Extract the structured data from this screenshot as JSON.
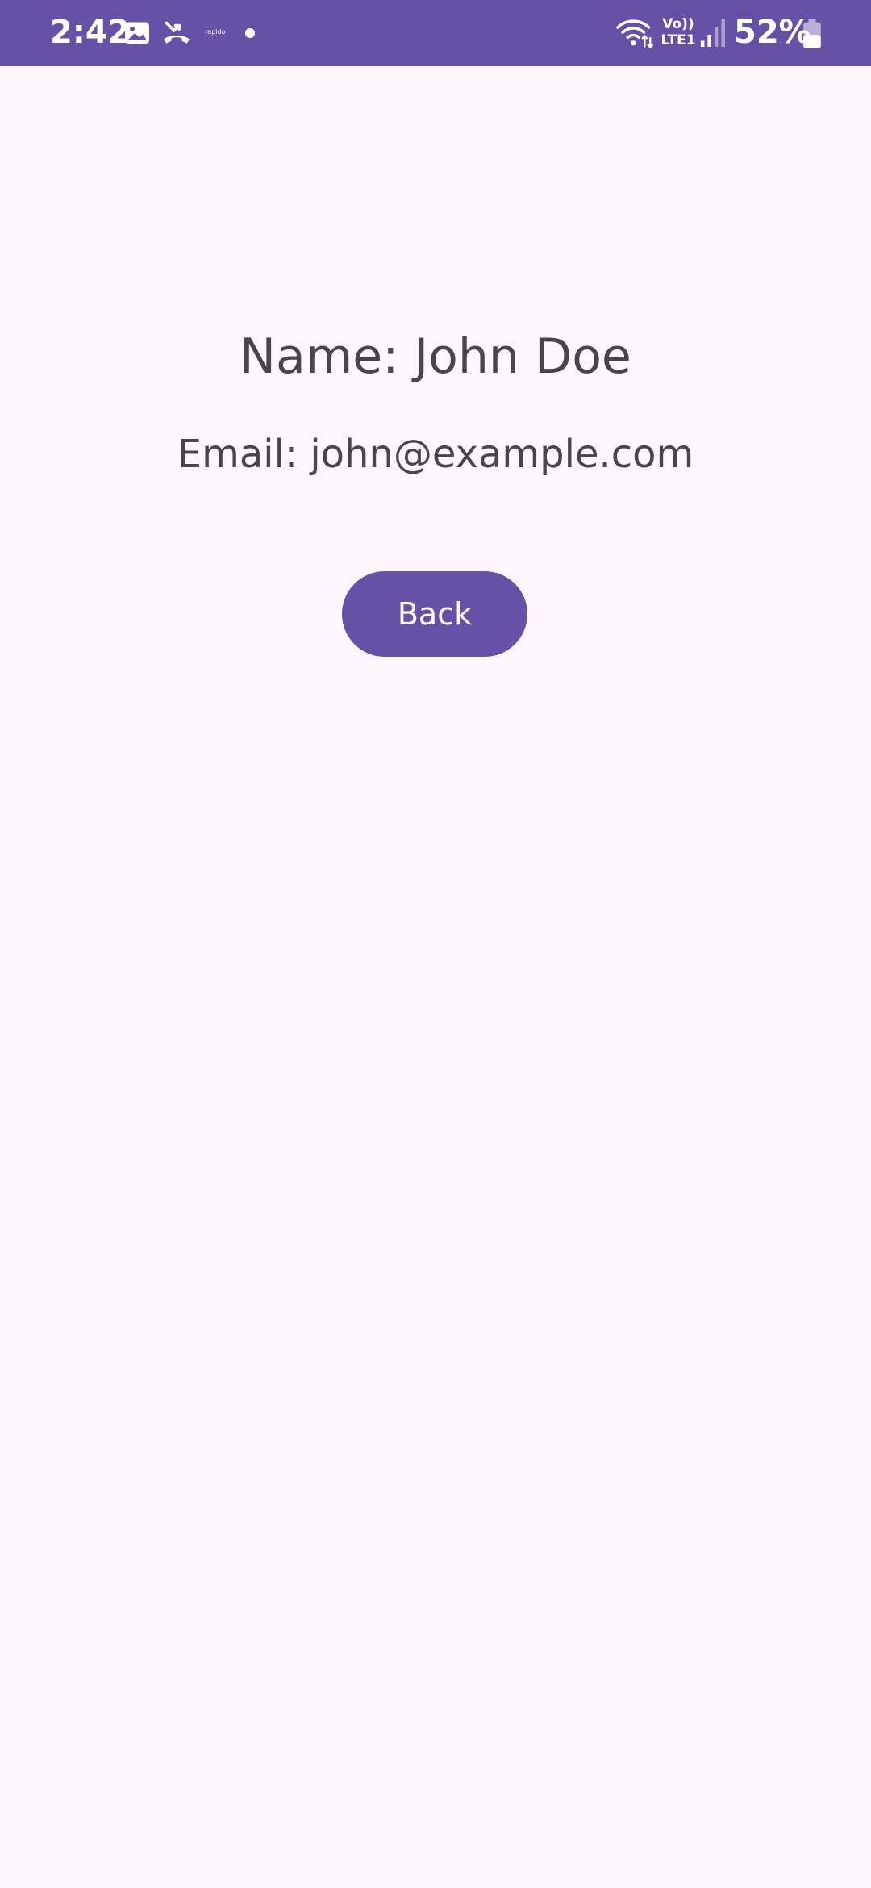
{
  "status_bar": {
    "time": "2:42",
    "notification_app_text": "rapido",
    "network_volte_line1": "Vo))",
    "network_volte_line2": "LTE1",
    "battery_percent": "52%",
    "background_color": "#6751a6",
    "icons": [
      "gallery-icon",
      "missed-call-icon",
      "rapido-notification",
      "notification-dot",
      "wifi-icon",
      "volte-indicator",
      "signal-icon",
      "battery-icon"
    ],
    "battery_level": 0.52
  },
  "profile": {
    "name_line": "Name: John Doe",
    "email_line": "Email: john@example.com"
  },
  "actions": {
    "back_label": "Back"
  },
  "theme": {
    "primary": "#6751a6",
    "background": "#fdf7fd",
    "text": "#48454e"
  }
}
